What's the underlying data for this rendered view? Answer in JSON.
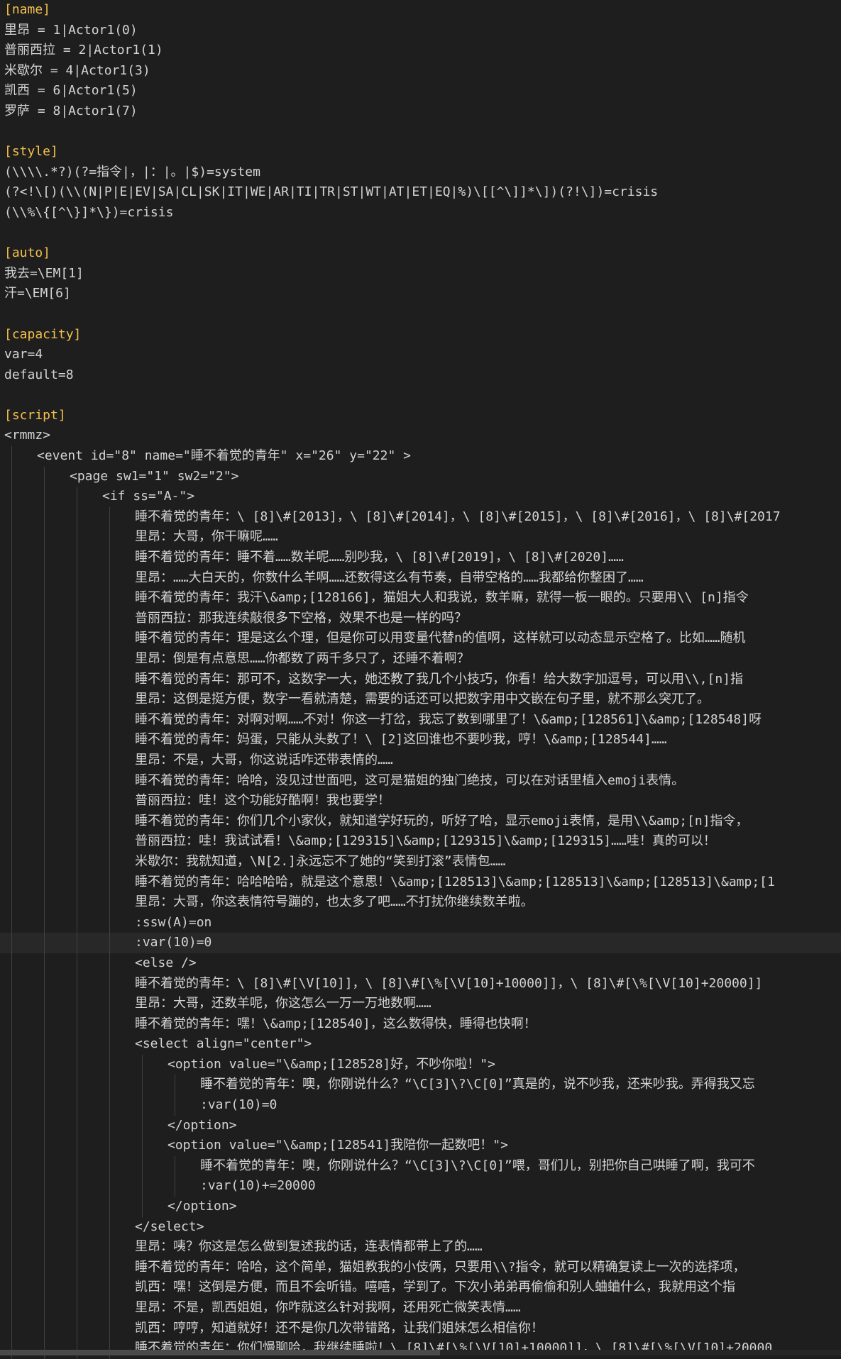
{
  "editor": {
    "lines": [
      {
        "text": "[name]",
        "cls": "c-sec",
        "indent": 0
      },
      {
        "text": "里昂 = 1|Actor1(0)",
        "cls": "c-def",
        "indent": 0
      },
      {
        "text": "普丽西拉 = 2|Actor1(1)",
        "cls": "c-def",
        "indent": 0
      },
      {
        "text": "米歇尔 = 4|Actor1(3)",
        "cls": "c-def",
        "indent": 0
      },
      {
        "text": "凯西 = 6|Actor1(5)",
        "cls": "c-def",
        "indent": 0
      },
      {
        "text": "罗萨 = 8|Actor1(7)",
        "cls": "c-def",
        "indent": 0
      },
      {
        "text": "",
        "cls": "c-def",
        "indent": 0
      },
      {
        "text": "[style]",
        "cls": "c-sec",
        "indent": 0
      },
      {
        "text": "(\\\\\\\\.*?)(?=指令|，|：|。|$)=system",
        "cls": "c-def",
        "indent": 0
      },
      {
        "text": "(?<!\\[)(\\\\(N|P|E|EV|SA|CL|SK|IT|WE|AR|TI|TR|ST|WT|AT|ET|EQ|%)\\[[^\\]]*\\])(?!\\])=crisis",
        "cls": "c-def",
        "indent": 0
      },
      {
        "text": "(\\\\%\\{[^\\}]*\\})=crisis",
        "cls": "c-def",
        "indent": 0
      },
      {
        "text": "",
        "cls": "c-def",
        "indent": 0
      },
      {
        "text": "[auto]",
        "cls": "c-sec",
        "indent": 0
      },
      {
        "text": "我去=\\EM[1]",
        "cls": "c-def",
        "indent": 0
      },
      {
        "text": "汗=\\EM[6]",
        "cls": "c-def",
        "indent": 0
      },
      {
        "text": "",
        "cls": "c-def",
        "indent": 0
      },
      {
        "text": "[capacity]",
        "cls": "c-sec",
        "indent": 0
      },
      {
        "text": "var=4",
        "cls": "c-def",
        "indent": 0
      },
      {
        "text": "default=8",
        "cls": "c-def",
        "indent": 0
      },
      {
        "text": "",
        "cls": "c-def",
        "indent": 0
      },
      {
        "text": "[script]",
        "cls": "c-sec",
        "indent": 0
      },
      {
        "text": "<rmmz>",
        "cls": "c-def",
        "indent": 0
      },
      {
        "text": "<event id=\"8\" name=\"睡不着觉的青年\" x=\"26\" y=\"22\" >",
        "cls": "c-def",
        "indent": 1
      },
      {
        "text": "<page sw1=\"1\" sw2=\"2\">",
        "cls": "c-def",
        "indent": 2
      },
      {
        "text": "<if ss=\"A-\">",
        "cls": "c-def",
        "indent": 3
      },
      {
        "text": "睡不着觉的青年：\\ [8]\\#[2013]，\\ [8]\\#[2014]，\\ [8]\\#[2015]，\\ [8]\\#[2016]，\\ [8]\\#[2017",
        "cls": "c-def",
        "indent": 4
      },
      {
        "text": "里昂：大哥，你干嘛呢……",
        "cls": "c-def",
        "indent": 4
      },
      {
        "text": "睡不着觉的青年：睡不着……数羊呢……别吵我，\\ [8]\\#[2019]，\\ [8]\\#[2020]……",
        "cls": "c-def",
        "indent": 4
      },
      {
        "text": "里昂：……大白天的，你数什么羊啊……还数得这么有节奏，自带空格的……我都给你整困了……",
        "cls": "c-def",
        "indent": 4
      },
      {
        "text": "睡不着觉的青年：我汗\\&amp;[128166]，猫姐大人和我说，数羊嘛，就得一板一眼的。只要用\\\\ [n]指令",
        "cls": "c-def",
        "indent": 4
      },
      {
        "text": "普丽西拉：那我连续敲很多下空格，效果不也是一样的吗？",
        "cls": "c-def",
        "indent": 4
      },
      {
        "text": "睡不着觉的青年：理是这么个理，但是你可以用变量代替n的值啊，这样就可以动态显示空格了。比如……随机",
        "cls": "c-def",
        "indent": 4
      },
      {
        "text": "里昂：倒是有点意思……你都数了两千多只了，还睡不着啊？",
        "cls": "c-def",
        "indent": 4
      },
      {
        "text": "睡不着觉的青年：那可不，这数字一大，她还教了我几个小技巧，你看！给大数字加逗号，可以用\\\\,[n]指",
        "cls": "c-def",
        "indent": 4
      },
      {
        "text": "里昂：这倒是挺方便，数字一看就清楚，需要的话还可以把数字用中文嵌在句子里，就不那么突兀了。",
        "cls": "c-def",
        "indent": 4
      },
      {
        "text": "睡不着觉的青年：对啊对啊……不对！你这一打岔，我忘了数到哪里了！\\&amp;[128561]\\&amp;[128548]呀",
        "cls": "c-def",
        "indent": 4
      },
      {
        "text": "睡不着觉的青年：妈蛋，只能从头数了！\\ [2]这回谁也不要吵我，哼！\\&amp;[128544]……",
        "cls": "c-def",
        "indent": 4
      },
      {
        "text": "里昂：不是，大哥，你这说话咋还带表情的……",
        "cls": "c-def",
        "indent": 4
      },
      {
        "text": "睡不着觉的青年：哈哈，没见过世面吧，这可是猫姐的独门绝技，可以在对话里植入emoji表情。",
        "cls": "c-def",
        "indent": 4
      },
      {
        "text": "普丽西拉：哇！这个功能好酷啊！我也要学！",
        "cls": "c-def",
        "indent": 4
      },
      {
        "text": "睡不着觉的青年：你们几个小家伙，就知道学好玩的，听好了哈，显示emoji表情，是用\\\\&amp;[n]指令，",
        "cls": "c-def",
        "indent": 4
      },
      {
        "text": "普丽西拉：哇！我试试看！\\&amp;[129315]\\&amp;[129315]\\&amp;[129315]……哇！真的可以！",
        "cls": "c-def",
        "indent": 4
      },
      {
        "text": "米歇尔：我就知道，\\N[2.]永远忘不了她的“笑到打滚”表情包……",
        "cls": "c-def",
        "indent": 4
      },
      {
        "text": "睡不着觉的青年：哈哈哈哈，就是这个意思！\\&amp;[128513]\\&amp;[128513]\\&amp;[128513]\\&amp;[1",
        "cls": "c-def",
        "indent": 4
      },
      {
        "text": "里昂：大哥，你这表情符号蹦的，也太多了吧……不打扰你继续数羊啦。",
        "cls": "c-def",
        "indent": 4
      },
      {
        "text": ":ssw(A)=on",
        "cls": "c-def",
        "indent": 4
      },
      {
        "text": ":var(10)=0",
        "cls": "c-def",
        "indent": 4,
        "current": true
      },
      {
        "text": "<else />",
        "cls": "c-def",
        "indent": 4
      },
      {
        "text": "睡不着觉的青年：\\ [8]\\#[\\V[10]]，\\ [8]\\#[\\%[\\V[10]+10000]]，\\ [8]\\#[\\%[\\V[10]+20000]]",
        "cls": "c-def",
        "indent": 4
      },
      {
        "text": "里昂：大哥，还数羊呢，你这怎么一万一万地数啊……",
        "cls": "c-def",
        "indent": 4
      },
      {
        "text": "睡不着觉的青年：嘿！\\&amp;[128540]，这么数得快，睡得也快啊！",
        "cls": "c-def",
        "indent": 4
      },
      {
        "text": "<select align=\"center\">",
        "cls": "c-def",
        "indent": 4
      },
      {
        "text": "<option value=\"\\&amp;[128528]好，不吵你啦！\">",
        "cls": "c-def",
        "indent": 5
      },
      {
        "text": "睡不着觉的青年：噢，你刚说什么？“\\C[3]\\?\\C[0]”真是的，说不吵我，还来吵我。弄得我又忘",
        "cls": "c-def",
        "indent": 6
      },
      {
        "text": ":var(10)=0",
        "cls": "c-def",
        "indent": 6
      },
      {
        "text": "</option>",
        "cls": "c-def",
        "indent": 5
      },
      {
        "text": "<option value=\"\\&amp;[128541]我陪你一起数吧！\">",
        "cls": "c-def",
        "indent": 5
      },
      {
        "text": "睡不着觉的青年：噢，你刚说什么？“\\C[3]\\?\\C[0]”喂，哥们儿，别把你自己哄睡了啊，我可不",
        "cls": "c-def",
        "indent": 6
      },
      {
        "text": ":var(10)+=20000",
        "cls": "c-def",
        "indent": 6
      },
      {
        "text": "</option>",
        "cls": "c-def",
        "indent": 5
      },
      {
        "text": "</select>",
        "cls": "c-def",
        "indent": 4
      },
      {
        "text": "里昂：咦？你这是怎么做到复述我的话，连表情都带上了的……",
        "cls": "c-def",
        "indent": 4
      },
      {
        "text": "睡不着觉的青年：哈哈，这个简单，猫姐教我的小伎俩，只要用\\\\?指令，就可以精确复读上一次的选择项，",
        "cls": "c-def",
        "indent": 4
      },
      {
        "text": "凯西：嘿！这倒是方便，而且不会听错。嘻嘻，学到了。下次小弟弟再偷偷和别人蛐蛐什么，我就用这个指",
        "cls": "c-def",
        "indent": 4
      },
      {
        "text": "里昂：不是，凯西姐姐，你咋就这么针对我啊，还用死亡微笑表情……",
        "cls": "c-def",
        "indent": 4
      },
      {
        "text": "凯西：哼哼，知道就好！还不是你几次带错路，让我们姐妹怎么相信你！",
        "cls": "c-def",
        "indent": 4
      },
      {
        "text": "睡不着觉的青年：你们慢聊哈，我继续睡啦！\\ [8]\\#[\\%[\\V[10]+10000]]，\\ [8]\\#[\\%[\\V[10]+20000",
        "cls": "c-def",
        "indent": 4
      }
    ]
  },
  "scrollbar": {
    "label": "horizontal-scrollbar"
  }
}
